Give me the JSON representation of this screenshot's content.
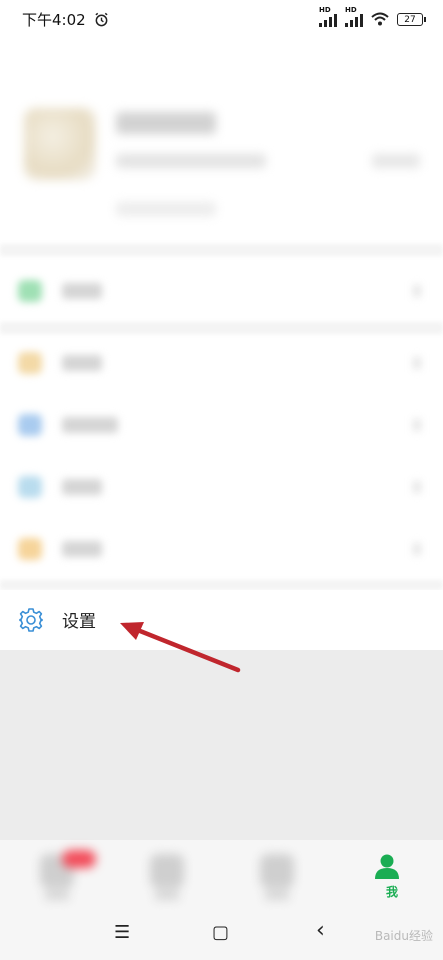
{
  "status_bar": {
    "time": "下午4:02",
    "alarm_icon": "alarm-clock-icon",
    "sim1": "HD",
    "sim2": "HD",
    "battery": "27"
  },
  "settings_row": {
    "icon": "gear-icon",
    "label": "设置"
  },
  "tab_bar": {
    "active_tab_label": "我",
    "active_color": "#1aad53"
  },
  "nav_bar": {
    "menu": "☰",
    "home": "▢",
    "back": "‹"
  },
  "annotation": {
    "arrow_color": "#c0262d"
  },
  "watermark": "Baidu经验"
}
